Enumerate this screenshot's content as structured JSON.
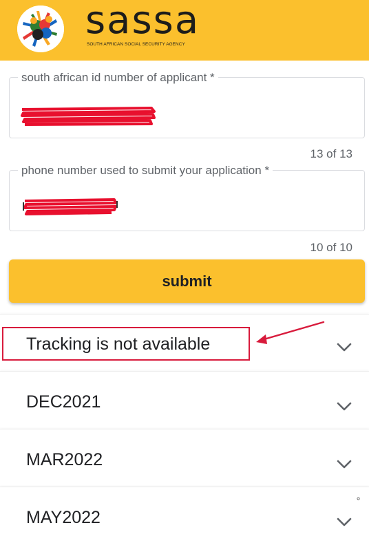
{
  "header": {
    "brand_name": "sassa",
    "brand_subtitle": "SOUTH AFRICAN SOCIAL SECURITY AGENCY",
    "background_color": "#fbc02d"
  },
  "form": {
    "id_field": {
      "label": "south african id number of applicant *",
      "counter": "13 of 13"
    },
    "phone_field": {
      "label": "phone number used to submit your application *",
      "counter": "10 of 10"
    },
    "submit_label": "submit"
  },
  "accordion": {
    "items": [
      {
        "label": "Tracking is not available",
        "icon": "chevron-down-icon"
      },
      {
        "label": "DEC2021",
        "icon": "chevron-down-icon"
      },
      {
        "label": "MAR2022",
        "icon": "chevron-down-icon"
      },
      {
        "label": "MAY2022",
        "icon": "chevron-down-icon"
      }
    ]
  },
  "annotation": {
    "color": "#d81b3c"
  }
}
